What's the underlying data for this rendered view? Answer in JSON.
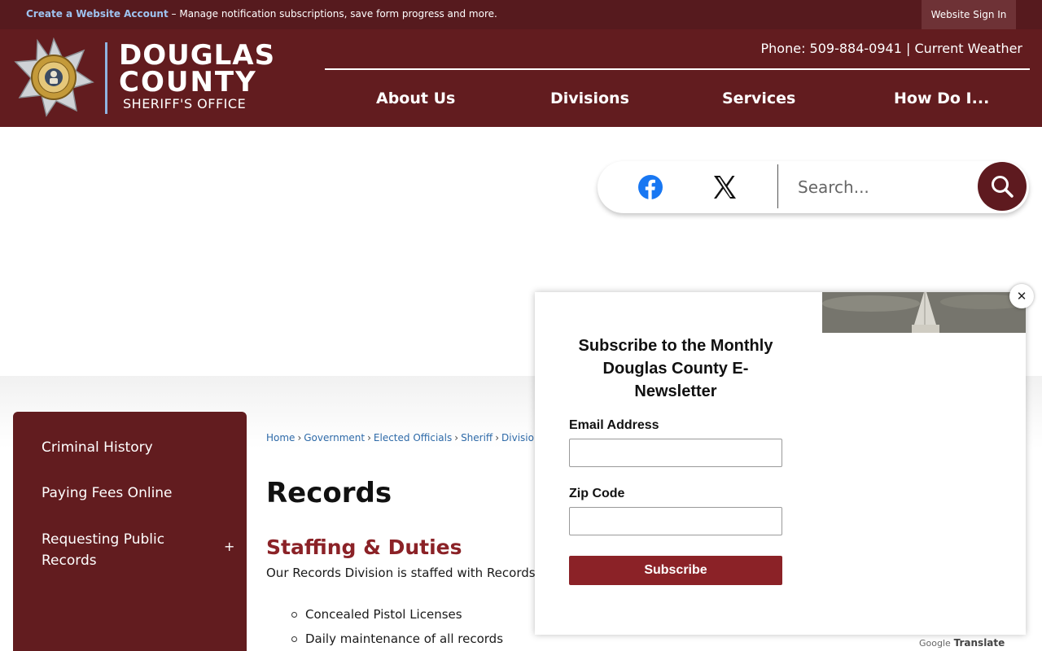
{
  "topbar": {
    "create_account_link": "Create a Website Account",
    "create_account_text": " – Manage notification subscriptions, save form progress and more.",
    "signin_label": "Website Sign In"
  },
  "header": {
    "logo_line1": "DOUGLAS",
    "logo_line2": "COUNTY",
    "logo_line3": "SHERIFF'S OFFICE",
    "phone": "Phone: 509-884-0941",
    "separator": " | ",
    "weather": "Current Weather",
    "nav": [
      "About Us",
      "Divisions",
      "Services",
      "How Do I..."
    ]
  },
  "search": {
    "placeholder": "Search..."
  },
  "sidebar": {
    "items": [
      "Criminal History",
      "Paying Fees Online",
      "Requesting Public Records"
    ],
    "expand_symbol": "+"
  },
  "breadcrumb": [
    "Home",
    "Government",
    "Elected Officials",
    "Sheriff",
    "Division"
  ],
  "main": {
    "title": "Records",
    "section_title": "Staffing & Duties",
    "body_text": "Our Records Division is staffed with Records",
    "duties": [
      "Concealed Pistol Licenses",
      "Daily maintenance of all records"
    ]
  },
  "translate": {
    "google": "Google",
    "label": "Translate"
  },
  "modal": {
    "title": "Subscribe to the Monthly Douglas County E-Newsletter",
    "email_label": "Email Address",
    "zip_label": "Zip Code",
    "subscribe_label": "Subscribe",
    "close_symbol": "✕"
  },
  "colors": {
    "brand_maroon": "#621c1f",
    "topbar": "#561a1e",
    "accent_red": "#8b2227",
    "link_blue": "#2e6aa8"
  },
  "icons": [
    "star-badge-icon",
    "facebook-icon",
    "x-twitter-icon",
    "search-icon",
    "close-icon",
    "plus-icon"
  ]
}
